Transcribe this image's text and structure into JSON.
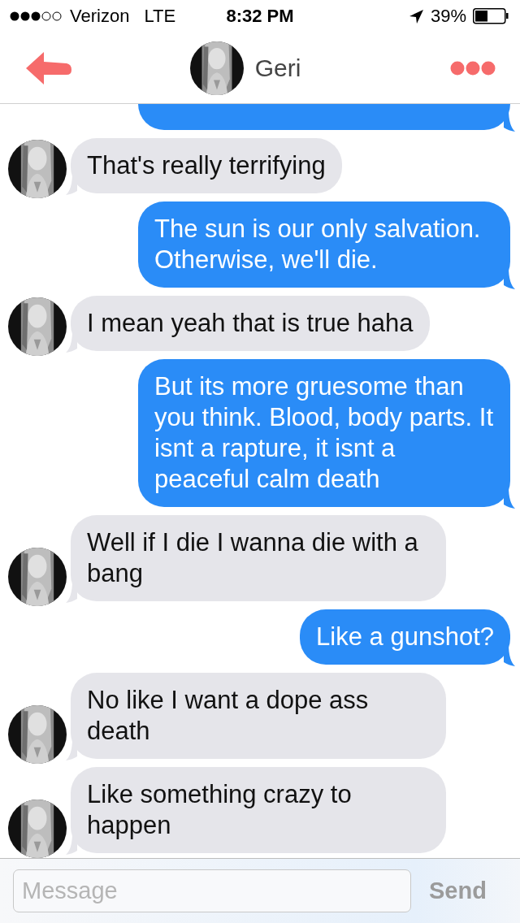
{
  "status_bar": {
    "carrier": "Verizon",
    "network": "LTE",
    "time": "8:32 PM",
    "battery": "39%"
  },
  "header": {
    "name": "Geri"
  },
  "messages": [
    {
      "kind": "outgoing"
    },
    {
      "kind": "incoming",
      "text": "That's really terrifying"
    },
    {
      "kind": "outgoing",
      "text": "The sun is our only salvation. Otherwise, we'll die."
    },
    {
      "kind": "incoming",
      "text": "I mean yeah that is true haha"
    },
    {
      "kind": "outgoing",
      "text": "But its more gruesome than you think. Blood, body parts. It isnt a rapture, it isnt a peaceful calm death"
    },
    {
      "kind": "incoming",
      "text": "Well if I die I wanna die with a bang"
    },
    {
      "kind": "outgoing",
      "text": "Like a gunshot?"
    },
    {
      "kind": "incoming",
      "text": "No like I want a dope ass death"
    },
    {
      "kind": "incoming",
      "text": "Like something crazy to happen"
    }
  ],
  "composer": {
    "placeholder": "Message",
    "send": "Send"
  }
}
